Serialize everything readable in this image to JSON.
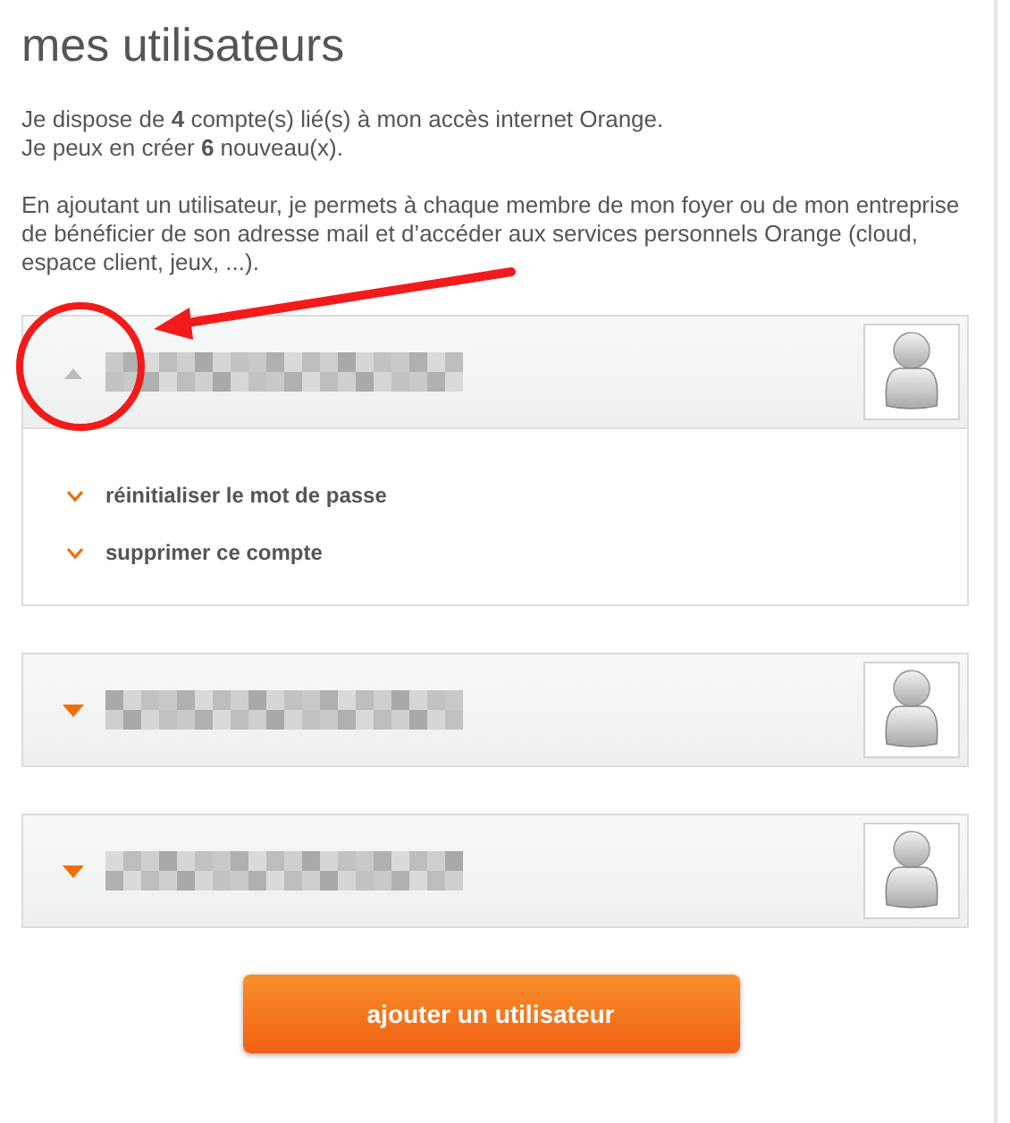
{
  "title": "mes utilisateurs",
  "intro": [
    "Je dispose de **4** compte(s) lié(s) à mon accès internet Orange.",
    "Je peux en créer **6** nouveau(x)."
  ],
  "description": "En ajoutant un utilisateur, je permets à chaque membre de mon foyer ou de mon entreprise de bénéficier de son adresse mail et d’accéder aux services personnels Orange (cloud, espace client, jeux, ...).",
  "accounts": [
    {
      "expanded": true,
      "actions": [
        "réinitialiser le mot de passe",
        "supprimer ce compte"
      ]
    },
    {
      "expanded": false
    },
    {
      "expanded": false
    }
  ],
  "add_button": "ajouter un utilisateur"
}
